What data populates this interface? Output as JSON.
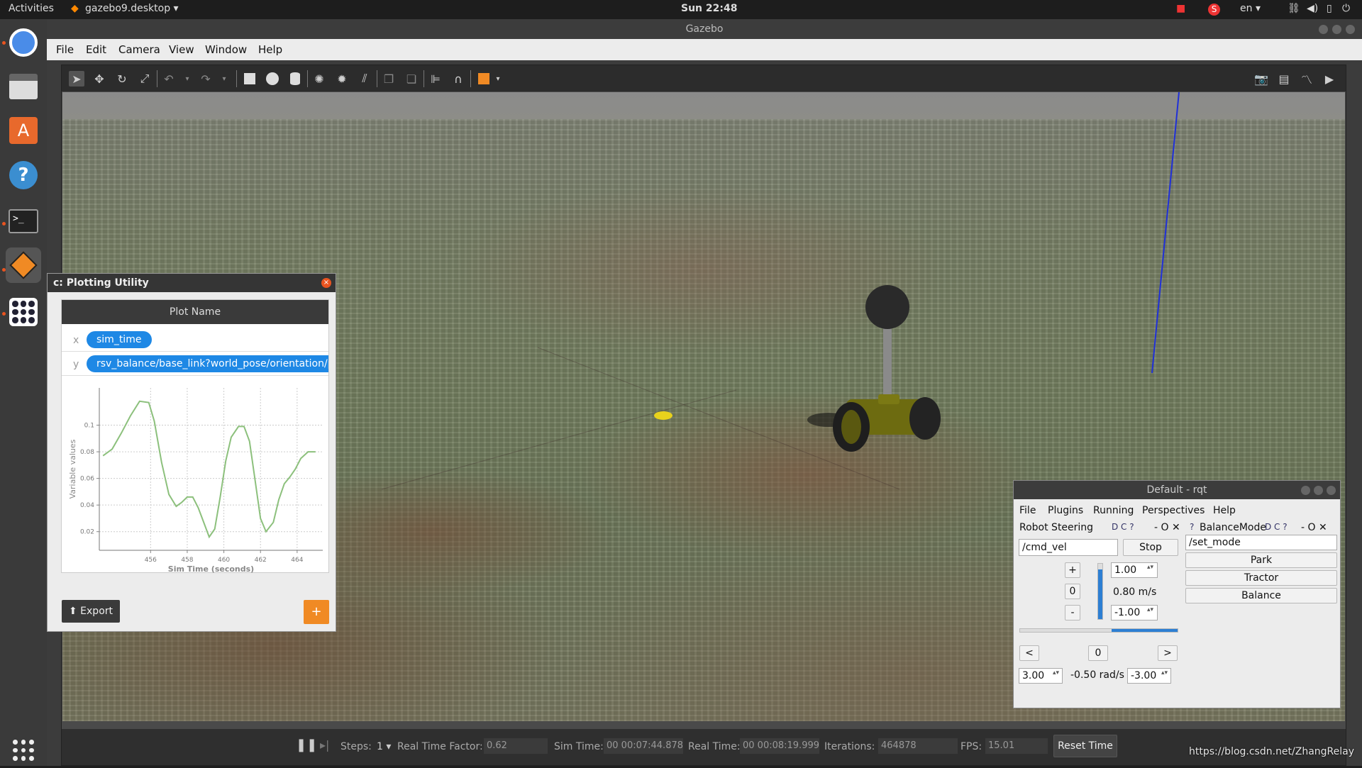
{
  "topbar": {
    "activities": "Activities",
    "app_name": "gazebo9.desktop",
    "clock": "Sun 22:48",
    "language": "en"
  },
  "gazebo": {
    "window_title": "Gazebo",
    "menu": [
      "File",
      "Edit",
      "Camera",
      "View",
      "Window",
      "Help"
    ],
    "status": {
      "steps_label": "Steps:",
      "steps_value": "1",
      "rtf_label": "Real Time Factor:",
      "rtf_value": "0.62",
      "sim_time_label": "Sim Time:",
      "sim_time_value": "00 00:07:44.878",
      "real_time_label": "Real Time:",
      "real_time_value": "00 00:08:19.999",
      "iterations_label": "Iterations:",
      "iterations_value": "464878",
      "fps_label": "FPS:",
      "fps_value": "15.01",
      "reset_time": "Reset Time"
    }
  },
  "plot": {
    "window_title": "c: Plotting Utility",
    "plot_name": "Plot Name",
    "x_axis_tag": "x",
    "x_topic": "sim_time",
    "y_axis_tag": "y",
    "y_topic": "rsv_balance/base_link?world_pose/orientation/p",
    "export_label": "Export",
    "add_label": "+",
    "chart_data": {
      "type": "line",
      "xlabel": "Sim Time (seconds)",
      "ylabel": "Variable values",
      "xlim": [
        453.2,
        465.4
      ],
      "ylim": [
        0.006,
        0.128
      ],
      "x_ticks": [
        456,
        458,
        460,
        462,
        464
      ],
      "y_ticks": [
        0.02,
        0.04,
        0.06,
        0.08,
        0.1
      ],
      "x_tick_labels": [
        "456",
        "458",
        "460",
        "462",
        "464"
      ],
      "y_tick_labels": [
        "0.02",
        "0.04",
        "0.06",
        "0.08",
        "0.1"
      ],
      "grid": true,
      "series": [
        {
          "color": "#8cc07c",
          "x": [
            453.4,
            453.9,
            454.4,
            454.9,
            455.4,
            455.9,
            456.2,
            456.6,
            457.0,
            457.4,
            457.7,
            458.0,
            458.3,
            458.6,
            458.9,
            459.2,
            459.5,
            459.8,
            460.1,
            460.4,
            460.8,
            461.1,
            461.4,
            461.7,
            462.0,
            462.3,
            462.7,
            463.0,
            463.3,
            463.6,
            463.9,
            464.2,
            464.6,
            465.0
          ],
          "y": [
            0.077,
            0.082,
            0.094,
            0.107,
            0.118,
            0.117,
            0.103,
            0.072,
            0.048,
            0.039,
            0.042,
            0.046,
            0.046,
            0.038,
            0.027,
            0.016,
            0.022,
            0.046,
            0.073,
            0.091,
            0.099,
            0.099,
            0.088,
            0.059,
            0.03,
            0.02,
            0.027,
            0.044,
            0.056,
            0.061,
            0.067,
            0.075,
            0.08,
            0.08
          ]
        }
      ]
    }
  },
  "rqt": {
    "window_title": "Default - rqt",
    "menu": [
      "File",
      "Plugins",
      "Running",
      "Perspectives",
      "Help"
    ],
    "steering": {
      "title": "Robot Steering",
      "topic": "/cmd_vel",
      "stop": "Stop",
      "plus": "+",
      "zero": "0",
      "minus": "-",
      "max_lin": "1.00",
      "lin_vel": "0.80 m/s",
      "min_lin": "-1.00",
      "left": "<",
      "ang_zero": "0",
      "right": ">",
      "max_ang": "3.00",
      "ang_vel": "-0.50 rad/s",
      "min_ang": "-3.00",
      "linear_fraction": 0.9,
      "angular_fraction": 0.583
    },
    "balance": {
      "title": "BalanceMode",
      "service": "/set_mode",
      "park": "Park",
      "tractor": "Tractor",
      "balance": "Balance"
    }
  },
  "watermark": "https://blog.csdn.net/ZhangRelay"
}
